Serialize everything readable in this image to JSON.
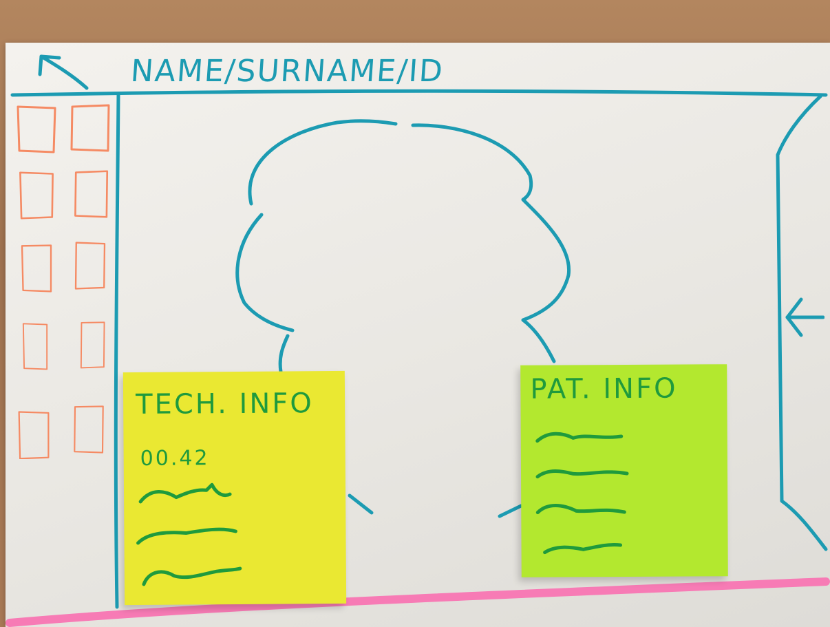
{
  "header": {
    "title": "NAME/SURNAME/ID"
  },
  "thumbnail_panel": {
    "count": 10
  },
  "notes": {
    "tech": {
      "title": "TECH. INFO",
      "value": "00.42"
    },
    "patient": {
      "title": "PAT. INFO"
    }
  },
  "colors": {
    "ink_blue": "#1c9bb2",
    "ink_orange": "#f58a63",
    "ink_green": "#1f9a3d",
    "sticky_yellow": "#eae832",
    "sticky_lime": "#b3e82f",
    "highlighter_pink": "#f77bb5",
    "paper": "#eeece8"
  },
  "icons": {
    "back": "back-arrow-icon",
    "collapse": "collapse-left-arrow-icon"
  }
}
